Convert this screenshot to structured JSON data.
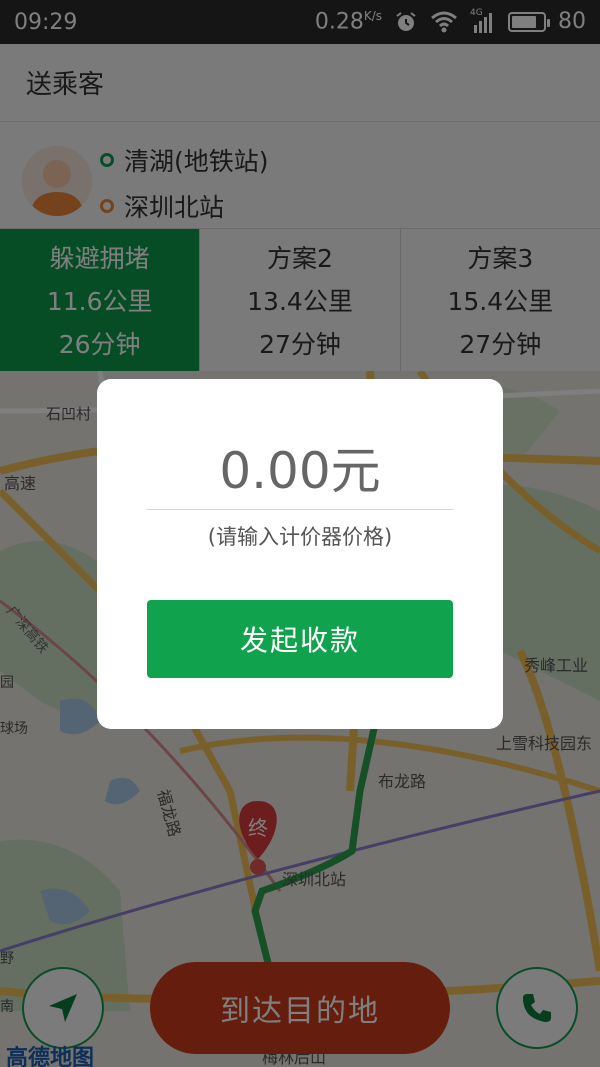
{
  "status_bar": {
    "time": "09:29",
    "speed": "0.28",
    "speed_unit": "K/s",
    "network": "4G",
    "battery": "80"
  },
  "header": {
    "title": "送乘客"
  },
  "route": {
    "start": "清湖(地铁站)",
    "end": "深圳北站"
  },
  "plans": [
    {
      "name": "躲避拥堵",
      "distance": "11.6公里",
      "time": "26分钟",
      "active": true
    },
    {
      "name": "方案2",
      "distance": "13.4公里",
      "time": "27分钟",
      "active": false
    },
    {
      "name": "方案3",
      "distance": "15.4公里",
      "time": "27分钟",
      "active": false
    }
  ],
  "map": {
    "labels": {
      "shiaocun": "石凹村",
      "gaosu": "高速",
      "guangshen": "广深高铁",
      "fulong": "福龙路",
      "bulong": "布龙路",
      "xiufeng": "秀峰工业",
      "shangxue": "上雪科技园东",
      "shenzhenbei": "深圳北站",
      "meilin": "梅林后山",
      "ye": "野",
      "nan": "南",
      "yuan": "园",
      "qiuchang": "球场",
      "end_marker": "终"
    },
    "logo": "高德地图"
  },
  "arrive_button": "到达目的地",
  "dialog": {
    "amount": "0.00元",
    "hint": "(请输入计价器价格)",
    "button": "发起收款"
  }
}
